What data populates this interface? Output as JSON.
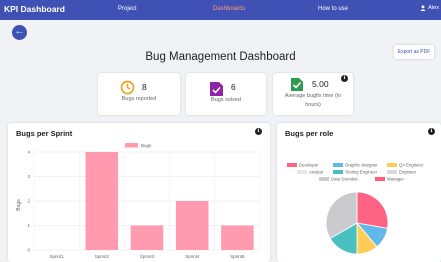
{
  "header": {
    "brand": "KPI Dashboard",
    "nav": [
      "Project",
      "Dashboards",
      "How to use"
    ],
    "active_index": 1,
    "user": "Alex"
  },
  "page": {
    "title": "Bug Management Dashboard",
    "export_label": "Export as PDF"
  },
  "stats": [
    {
      "value": "8",
      "label": "Bugs reported",
      "icon": "clock-icon",
      "color": "#f0a020"
    },
    {
      "value": "6",
      "label": "Bugs solved",
      "icon": "bug-check-icon",
      "color": "#8e24aa"
    },
    {
      "value": "5.00",
      "label": "Average bugfix time (in hours)",
      "icon": "check-doc-icon",
      "color": "#2e9a4e"
    }
  ],
  "info_glyph": "i",
  "chart_left": {
    "title": "Bugs per Sprint",
    "chart_data": {
      "type": "bar",
      "categories": [
        "Sprint1",
        "Sprint2",
        "Sprint3",
        "Sprint4",
        "Sprint5"
      ],
      "series": [
        {
          "name": "Bugs",
          "values": [
            0,
            4,
            1,
            2,
            1
          ],
          "color": "#ff9aaf"
        }
      ],
      "ylabel": "Bugs",
      "ylim": [
        0,
        4
      ],
      "yticks": [
        "0",
        "1",
        "2",
        "3",
        "4"
      ],
      "grid": true,
      "legend": "top-center"
    }
  },
  "chart_right": {
    "title": "Bugs per role",
    "chart_data": {
      "type": "pie",
      "categories": [
        "Developer",
        "Graphic designer",
        "QA Engineer",
        "Analyst",
        "Testing Engineer",
        "Engineer",
        "Data Scientist",
        "Manager"
      ],
      "values": [
        2.5,
        1,
        1,
        0,
        1.5,
        0,
        3,
        0
      ],
      "colors": [
        "#ff6384",
        "#63b8ea",
        "#ffcd56",
        "#e6e6e6",
        "#4bc0c0",
        "#d9d9d9",
        "#c9cbcf",
        "#ff5a7a"
      ],
      "legend": "top"
    }
  }
}
